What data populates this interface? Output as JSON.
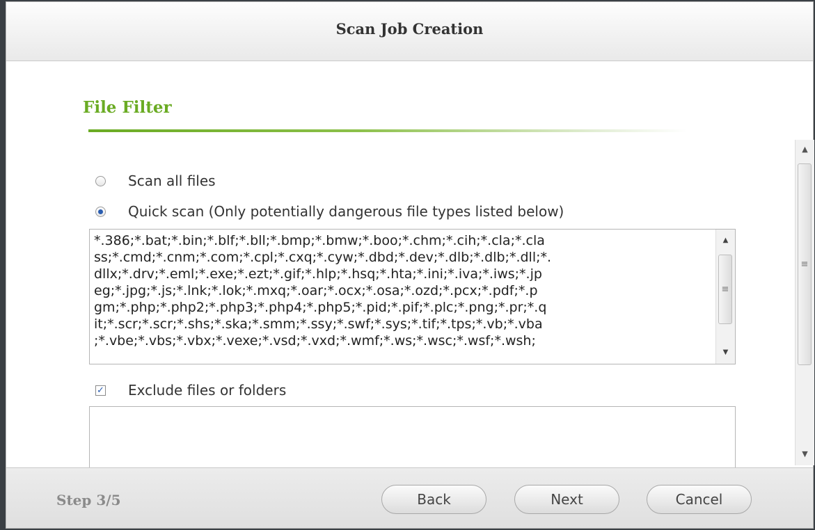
{
  "dialog": {
    "title": "Scan Job Creation"
  },
  "section": {
    "title": "File Filter"
  },
  "options": {
    "scan_all_label": "Scan all files",
    "quick_scan_label": "Quick scan (Only potentially dangerous file types listed below)",
    "quick_scan_selected": true,
    "exclude_label": "Exclude files or folders",
    "exclude_checked": true
  },
  "file_types_text": "*.386;*.bat;*.bin;*.blf;*.bll;*.bmp;*.bmw;*.boo;*.chm;*.cih;*.cla;*.cla\nss;*.cmd;*.cnm;*.com;*.cpl;*.cxq;*.cyw;*.dbd;*.dev;*.dlb;*.dlb;*.dll;*.\ndllx;*.drv;*.eml;*.exe;*.ezt;*.gif;*.hlp;*.hsq;*.hta;*.ini;*.iva;*.iws;*.jp\neg;*.jpg;*.js;*.lnk;*.lok;*.mxq;*.oar;*.ocx;*.osa;*.ozd;*.pcx;*.pdf;*.p\ngm;*.php;*.php2;*.php3;*.php4;*.php5;*.pid;*.pif;*.plc;*.png;*.pr;*.q\nit;*.scr;*.scr;*.shs;*.ska;*.smm;*.ssy;*.swf;*.sys;*.tif;*.tps;*.vb;*.vba\n;*.vbe;*.vbs;*.vbx;*.vexe;*.vsd;*.vxd;*.wmf;*.ws;*.wsc;*.wsf;*.wsh;",
  "exclude_text": "",
  "footer": {
    "step": "Step 3/5",
    "back_label": "Back",
    "next_label": "Next",
    "cancel_label": "Cancel"
  },
  "icons": {
    "scroll_up": "▲",
    "scroll_down": "▼",
    "grip": "≡",
    "check": "✓"
  }
}
